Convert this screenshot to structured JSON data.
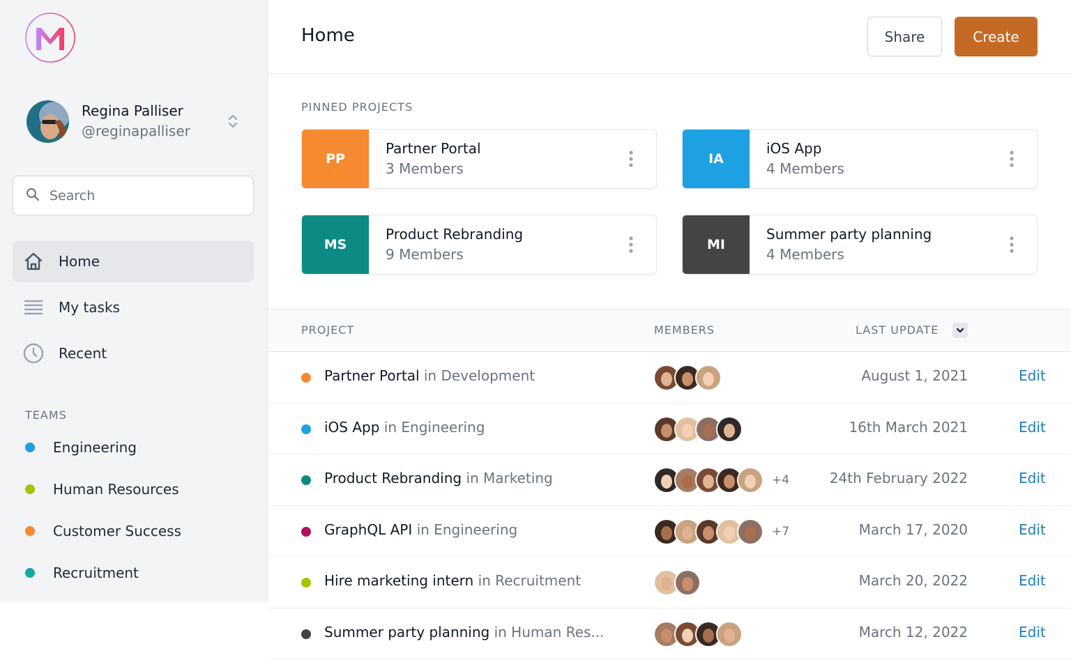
{
  "app": {
    "logo_icon": "m-logo-icon",
    "logo_colors": [
      "#c084fc",
      "#f43f5e"
    ]
  },
  "user": {
    "name": "Regina Palliser",
    "handle": "@reginapalliser",
    "switch_icon": "chevron-up-down-icon"
  },
  "search": {
    "placeholder": "Search",
    "value": "",
    "icon": "search-icon"
  },
  "nav": {
    "items": [
      {
        "label": "Home",
        "icon": "home-icon",
        "active": true
      },
      {
        "label": "My tasks",
        "icon": "list-icon",
        "active": false
      },
      {
        "label": "Recent",
        "icon": "clock-icon",
        "active": false
      }
    ]
  },
  "teams": {
    "title": "TEAMS",
    "items": [
      {
        "label": "Engineering",
        "color": "#1da1e2"
      },
      {
        "label": "Human Resources",
        "color": "#a3c408"
      },
      {
        "label": "Customer Success",
        "color": "#f58a31"
      },
      {
        "label": "Recruitment",
        "color": "#14a8a6"
      }
    ]
  },
  "header": {
    "title": "Home",
    "share_label": "Share",
    "create_label": "Create",
    "accent_color": "#c56a25"
  },
  "pinned": {
    "title": "PINNED PROJECTS",
    "items": [
      {
        "initials": "PP",
        "name": "Partner Portal",
        "members": "3 Members",
        "color": "#f58a31"
      },
      {
        "initials": "IA",
        "name": "iOS App",
        "members": "4 Members",
        "color": "#1da1e2"
      },
      {
        "initials": "MS",
        "name": "Product Rebranding",
        "members": "9 Members",
        "color": "#0e8a84"
      },
      {
        "initials": "MI",
        "name": "Summer party planning",
        "members": "4 Members",
        "color": "#444444"
      }
    ]
  },
  "table": {
    "headers": {
      "project": "PROJECT",
      "members": "MEMBERS",
      "last_update": "LAST UPDATE"
    },
    "sort_icon": "chevron-down-icon",
    "edit_label": "Edit",
    "rows": [
      {
        "name": "Partner Portal",
        "team": "in Development",
        "color": "#f58a31",
        "avatars": 3,
        "more": "",
        "date": "August 1, 2021"
      },
      {
        "name": "iOS App",
        "team": "in Engineering",
        "color": "#1da1e2",
        "avatars": 4,
        "more": "",
        "date": "16th March 2021"
      },
      {
        "name": "Product Rebranding",
        "team": "in Marketing",
        "color": "#0e8a84",
        "avatars": 5,
        "more": "+4",
        "date": "24th February 2022"
      },
      {
        "name": "GraphQL API",
        "team": "in Engineering",
        "color": "#b0115d",
        "avatars": 5,
        "more": "+7",
        "date": "March 17, 2020"
      },
      {
        "name": "Hire marketing intern",
        "team": "in Recruitment",
        "color": "#a3c408",
        "avatars": 2,
        "more": "",
        "date": "March 20, 2022"
      },
      {
        "name": "Summer party planning",
        "team": "in Human Res...",
        "color": "#444444",
        "avatars": 4,
        "more": "",
        "date": "March 12, 2022"
      }
    ]
  }
}
